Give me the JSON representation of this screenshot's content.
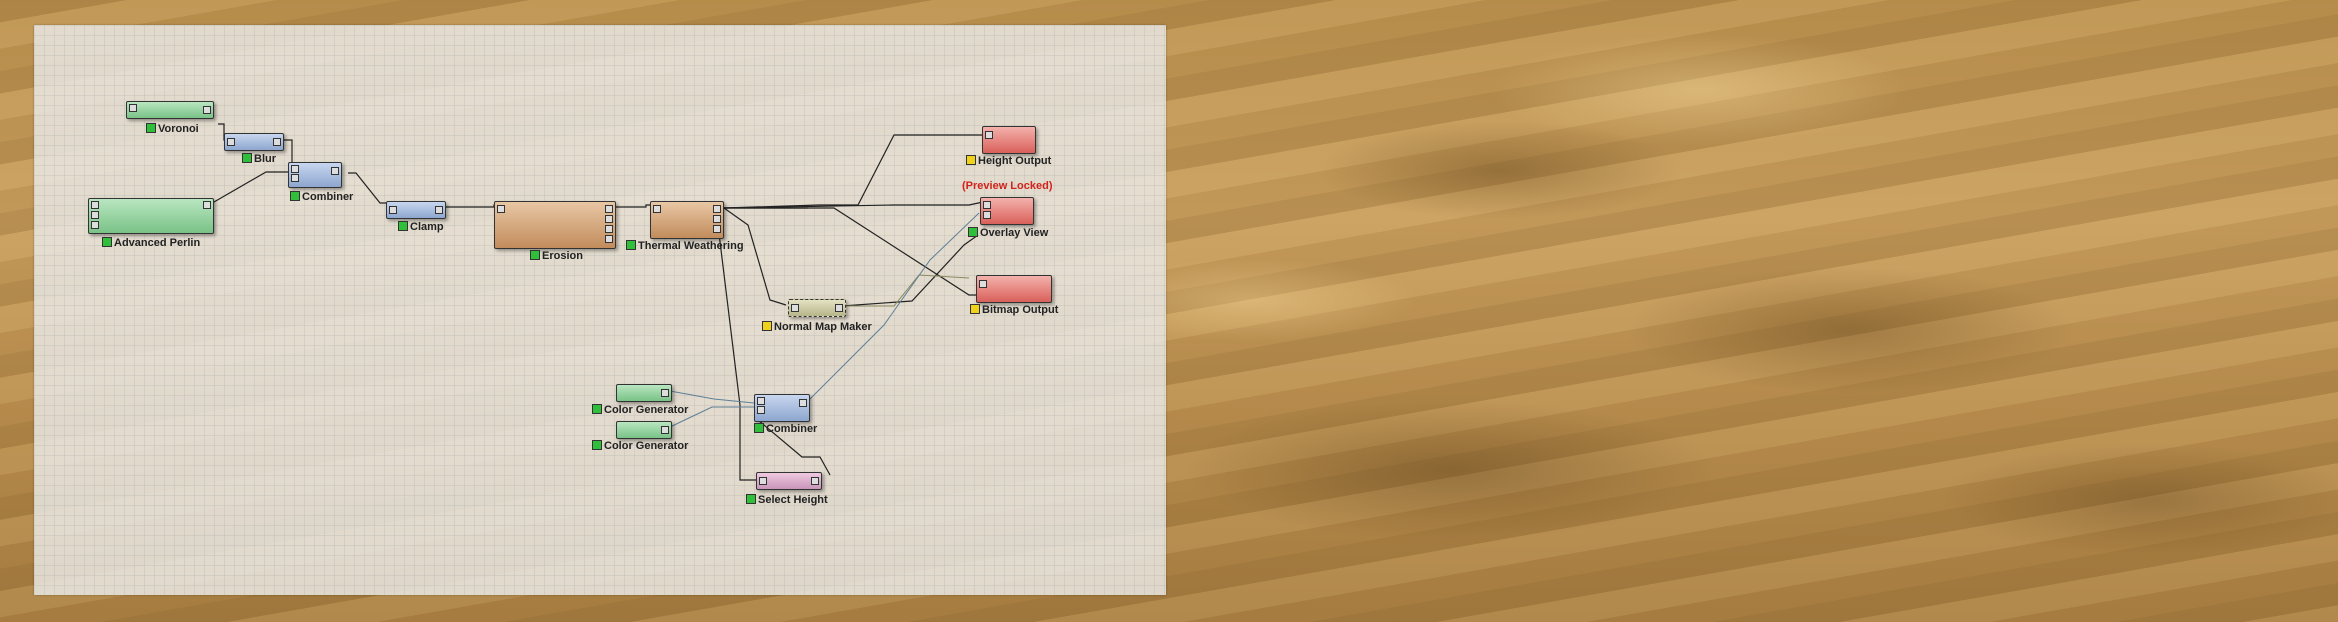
{
  "colors": {
    "green_swatch": "#2fbf3a",
    "yellow_swatch": "#f0d21a",
    "locked_text": "#d2231b"
  },
  "nodes": {
    "voronoi": "Voronoi",
    "blur": "Blur",
    "combiner1": "Combiner",
    "advanced_perlin": "Advanced Perlin",
    "clamp": "Clamp",
    "erosion": "Erosion",
    "thermal_weathering": "Thermal Weathering",
    "height_output": "Height Output",
    "overlay_view": "Overlay View",
    "preview_locked": "(Preview Locked)",
    "bitmap_output": "Bitmap Output",
    "normal_map_maker": "Normal Map Maker",
    "color_generator1": "Color Generator",
    "color_generator2": "Color Generator",
    "combiner2": "Combiner",
    "select_height": "Select Height"
  }
}
